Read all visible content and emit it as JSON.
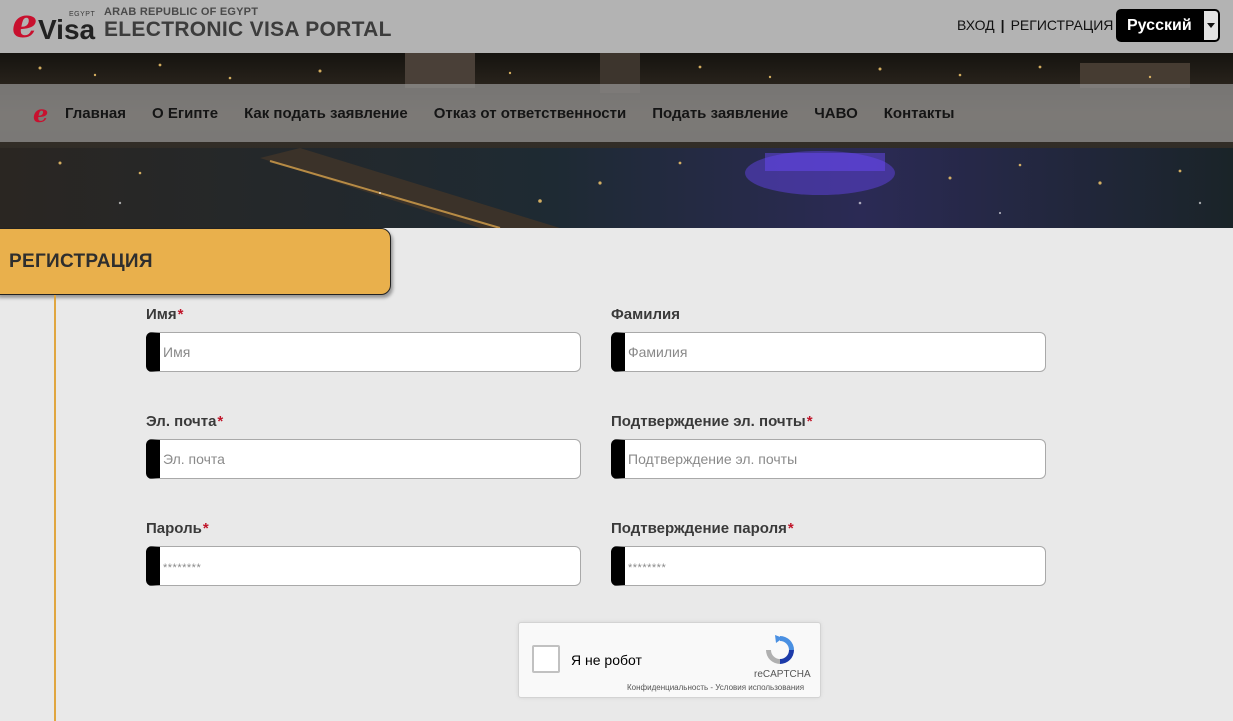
{
  "header": {
    "logo_small": "EGYPT",
    "logo_e": "e",
    "logo_word": "Visa",
    "republic": "ARAB REPUBLIC OF EGYPT",
    "portal_title": "ELECTRONIC VISA PORTAL",
    "login": "ВХОД",
    "separator": "|",
    "register": "РЕГИСТРАЦИЯ",
    "language": "Русский"
  },
  "nav": {
    "logo": "e",
    "items": [
      "Главная",
      "О Египте",
      "Как подать заявление",
      "Отказ от ответственности",
      "Подать заявление",
      "ЧАВО",
      "Контакты"
    ]
  },
  "section_title": "РЕГИСТРАЦИЯ",
  "form": {
    "required_mark": "*",
    "first_name": {
      "label": "Имя",
      "placeholder": "Имя",
      "value": ""
    },
    "last_name": {
      "label": "Фамилия",
      "placeholder": "Фамилия",
      "value": ""
    },
    "email": {
      "label": "Эл. почта",
      "placeholder": "Эл. почта",
      "value": ""
    },
    "email_confirm": {
      "label": "Подтверждение эл. почты",
      "placeholder": "Подтверждение эл. почты",
      "value": ""
    },
    "password": {
      "label": "Пароль",
      "placeholder": "********",
      "value": ""
    },
    "password_confirm": {
      "label": "Подтверждение пароля",
      "placeholder": "********",
      "value": ""
    }
  },
  "captcha": {
    "label": "Я не робот",
    "brand": "reCAPTCHA",
    "links": "Конфиденциальность - Условия использования"
  },
  "colors": {
    "accent": "#e9b04c",
    "required": "#c0152a",
    "logo_red": "#c8102e"
  }
}
